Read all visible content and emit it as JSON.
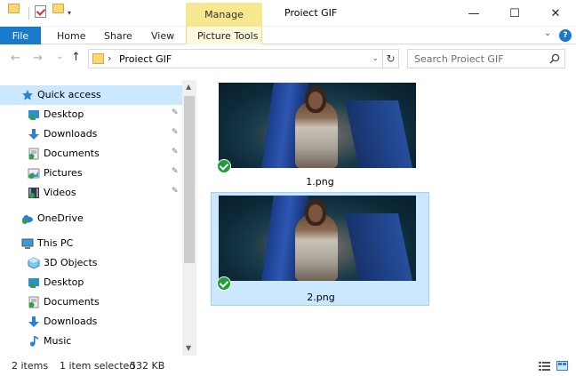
{
  "titlebar": {
    "manage_label": "Manage",
    "window_title": "Proiect GIF",
    "controls": {
      "minimize": "—",
      "maximize": "☐",
      "close": "✕"
    }
  },
  "ribbon": {
    "tabs": [
      "File",
      "Home",
      "Share",
      "View",
      "Picture Tools"
    ],
    "expand_glyph": "⌄",
    "help_glyph": "?"
  },
  "nav": {
    "back": "←",
    "forward": "→",
    "recent": "⌄",
    "up": "↑"
  },
  "address": {
    "separator": "›",
    "path": "Proiect GIF",
    "dropdown": "⌄",
    "refresh": "↻"
  },
  "search": {
    "placeholder": "Search Proiect GIF"
  },
  "sidebar": {
    "items": [
      {
        "label": "Quick access",
        "icon": "star-icon",
        "selected": true
      },
      {
        "label": "Desktop",
        "icon": "desktop-icon",
        "pinned": true
      },
      {
        "label": "Downloads",
        "icon": "downloads-icon",
        "pinned": true
      },
      {
        "label": "Documents",
        "icon": "documents-icon",
        "pinned": true
      },
      {
        "label": "Pictures",
        "icon": "pictures-icon",
        "pinned": true
      },
      {
        "label": "Videos",
        "icon": "videos-icon",
        "pinned": true
      },
      {
        "label": "OneDrive",
        "icon": "onedrive-icon"
      },
      {
        "label": "This PC",
        "icon": "pc-icon"
      },
      {
        "label": "3D Objects",
        "icon": "3d-objects-icon"
      },
      {
        "label": "Desktop",
        "icon": "desktop-icon"
      },
      {
        "label": "Documents",
        "icon": "documents-icon"
      },
      {
        "label": "Downloads",
        "icon": "downloads-icon"
      },
      {
        "label": "Music",
        "icon": "music-icon"
      }
    ],
    "pin_glyph": "📌"
  },
  "files": [
    {
      "name": "1.png",
      "selected": false,
      "synced": true
    },
    {
      "name": "2.png",
      "selected": true,
      "synced": true
    }
  ],
  "status": {
    "item_count": "2 items",
    "selection": "1 item selected",
    "size": "532 KB"
  },
  "colors": {
    "accent": "#1979ca",
    "selection": "#cce8ff",
    "manage_tab": "#f7e88f",
    "sync_check": "#1e9e38"
  }
}
